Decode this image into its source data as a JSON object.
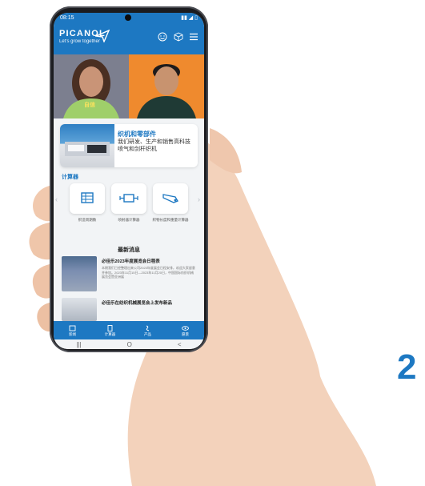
{
  "status": {
    "time": "08:15",
    "right": ""
  },
  "app": {
    "logo": "PICANOL",
    "tagline": "Let's grow together"
  },
  "hero": {
    "label": "自信"
  },
  "card": {
    "title": "织机和零部件",
    "body": "我们研发、生产和销售高科技喷气和剑杆织机"
  },
  "section": {
    "calculator": "计算器"
  },
  "calculators": [
    {
      "icon": "spreadsheet-icon",
      "label": "织造周期数"
    },
    {
      "icon": "tension-icon",
      "label": "喷射器计算器"
    },
    {
      "icon": "nozzle-icon",
      "label": "织物长度和重量计算器"
    }
  ],
  "news": {
    "title": "最新消息",
    "items": [
      {
        "headline": "必佳乐2023年度展览会日程表",
        "text": "本期我们已经整理出来公司2023年度展会日程安排，欢迎大家留意并参加。2023年11月15日—2023年11月20日，中国国际纺织机械展览会暨亚洲展"
      },
      {
        "headline": "必佳乐在纺织机械展览会上发布新品",
        "text": ""
      }
    ]
  },
  "tabs": [
    {
      "icon": "news-icon",
      "label": "新闻"
    },
    {
      "icon": "calculator-icon",
      "label": "计算器"
    },
    {
      "icon": "product-icon",
      "label": "产品"
    },
    {
      "icon": "eye-icon",
      "label": "愿景"
    }
  ],
  "nav": {
    "recent": "|||",
    "home": "O",
    "back": "<"
  },
  "slide_number": "2",
  "colors": {
    "brand": "#1d78c2",
    "accent": "#ef8a2e"
  }
}
